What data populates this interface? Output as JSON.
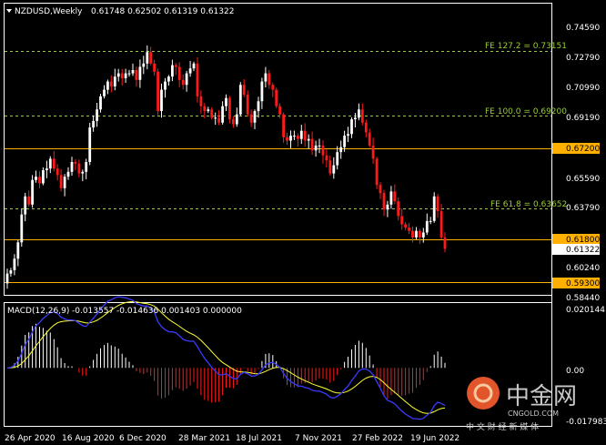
{
  "chart_data": [
    {
      "type": "candlestick",
      "title": "NZDUSD,Weekly",
      "ohlc_header": "0.61748 0.62502 0.61319 0.61322",
      "ylim": [
        0.585,
        0.7625
      ],
      "y_ticks": [
        "0.74590",
        "0.72790",
        "0.70990",
        "0.69190",
        "0.67200",
        "0.65590",
        "0.63790",
        "0.61800",
        "0.61322",
        "0.60240",
        "0.58440",
        "0.59300"
      ],
      "x_labels": [
        "26 Apr 2020",
        "16 Aug 2020",
        "6 Dec 2020",
        "28 Mar 2021",
        "18 Jul 2021",
        "7 Nov 2021",
        "27 Feb 2022",
        "19 Jun 2022"
      ],
      "bull_color": "#ffffff",
      "bear_color": "#ff1a1a",
      "fib_levels": [
        {
          "label": "FE 127.2 = 0.73151",
          "value": 0.73151
        },
        {
          "label": "FE 100.0 = 0.69200",
          "value": 0.692
        },
        {
          "label": "FE 61.8 = 0.63652",
          "value": 0.63652
        }
      ],
      "horizontal_levels": [
        {
          "value": 0.672,
          "label": "0.67200"
        },
        {
          "value": 0.618,
          "label": "0.61800"
        },
        {
          "value": 0.593,
          "label": "0.59300"
        }
      ],
      "level_color": "#ffb000",
      "current_price": "0.61322",
      "closes": [
        0.598,
        0.6,
        0.607,
        0.617,
        0.634,
        0.645,
        0.64,
        0.655,
        0.657,
        0.653,
        0.661,
        0.662,
        0.668,
        0.662,
        0.658,
        0.65,
        0.657,
        0.66,
        0.666,
        0.665,
        0.659,
        0.66,
        0.666,
        0.687,
        0.691,
        0.698,
        0.706,
        0.71,
        0.715,
        0.712,
        0.718,
        0.72,
        0.717,
        0.72,
        0.72,
        0.722,
        0.716,
        0.724,
        0.726,
        0.733,
        0.726,
        0.721,
        0.697,
        0.71,
        0.715,
        0.718,
        0.725,
        0.724,
        0.716,
        0.713,
        0.72,
        0.723,
        0.726,
        0.706,
        0.7,
        0.697,
        0.698,
        0.693,
        0.693,
        0.69,
        0.7,
        0.705,
        0.692,
        0.689,
        0.695,
        0.713,
        0.707,
        0.695,
        0.69,
        0.697,
        0.703,
        0.715,
        0.72,
        0.713,
        0.71,
        0.7,
        0.695,
        0.681,
        0.679,
        0.682,
        0.682,
        0.68,
        0.685,
        0.679,
        0.68,
        0.673,
        0.676,
        0.676,
        0.67,
        0.667,
        0.659,
        0.664,
        0.672,
        0.675,
        0.682,
        0.683,
        0.692,
        0.693,
        0.698,
        0.69,
        0.684,
        0.676,
        0.668,
        0.652,
        0.647,
        0.637,
        0.64,
        0.648,
        0.642,
        0.633,
        0.628,
        0.626,
        0.624,
        0.62,
        0.624,
        0.62,
        0.623,
        0.63,
        0.63,
        0.645,
        0.636,
        0.62,
        0.613
      ],
      "macd": {
        "label": "MACD(12,26,9)",
        "values": "-0.013557 -0.014636 0.001403 0.000000",
        "ylim": [
          -0.01798,
          0.02014
        ],
        "y_ticks": [
          "0.020144",
          "0.00",
          "-0.017983"
        ],
        "histogram_color": "#ffffff",
        "histogram_negative_color": "#ff1a1a",
        "signal_color": "#ffff33",
        "line_color": "#3a3aff"
      }
    }
  ],
  "watermark": {
    "logo_text": "中金网",
    "domain": "CNGOLD.COM",
    "slogan": "中 文 财 经 新 媒 体"
  }
}
